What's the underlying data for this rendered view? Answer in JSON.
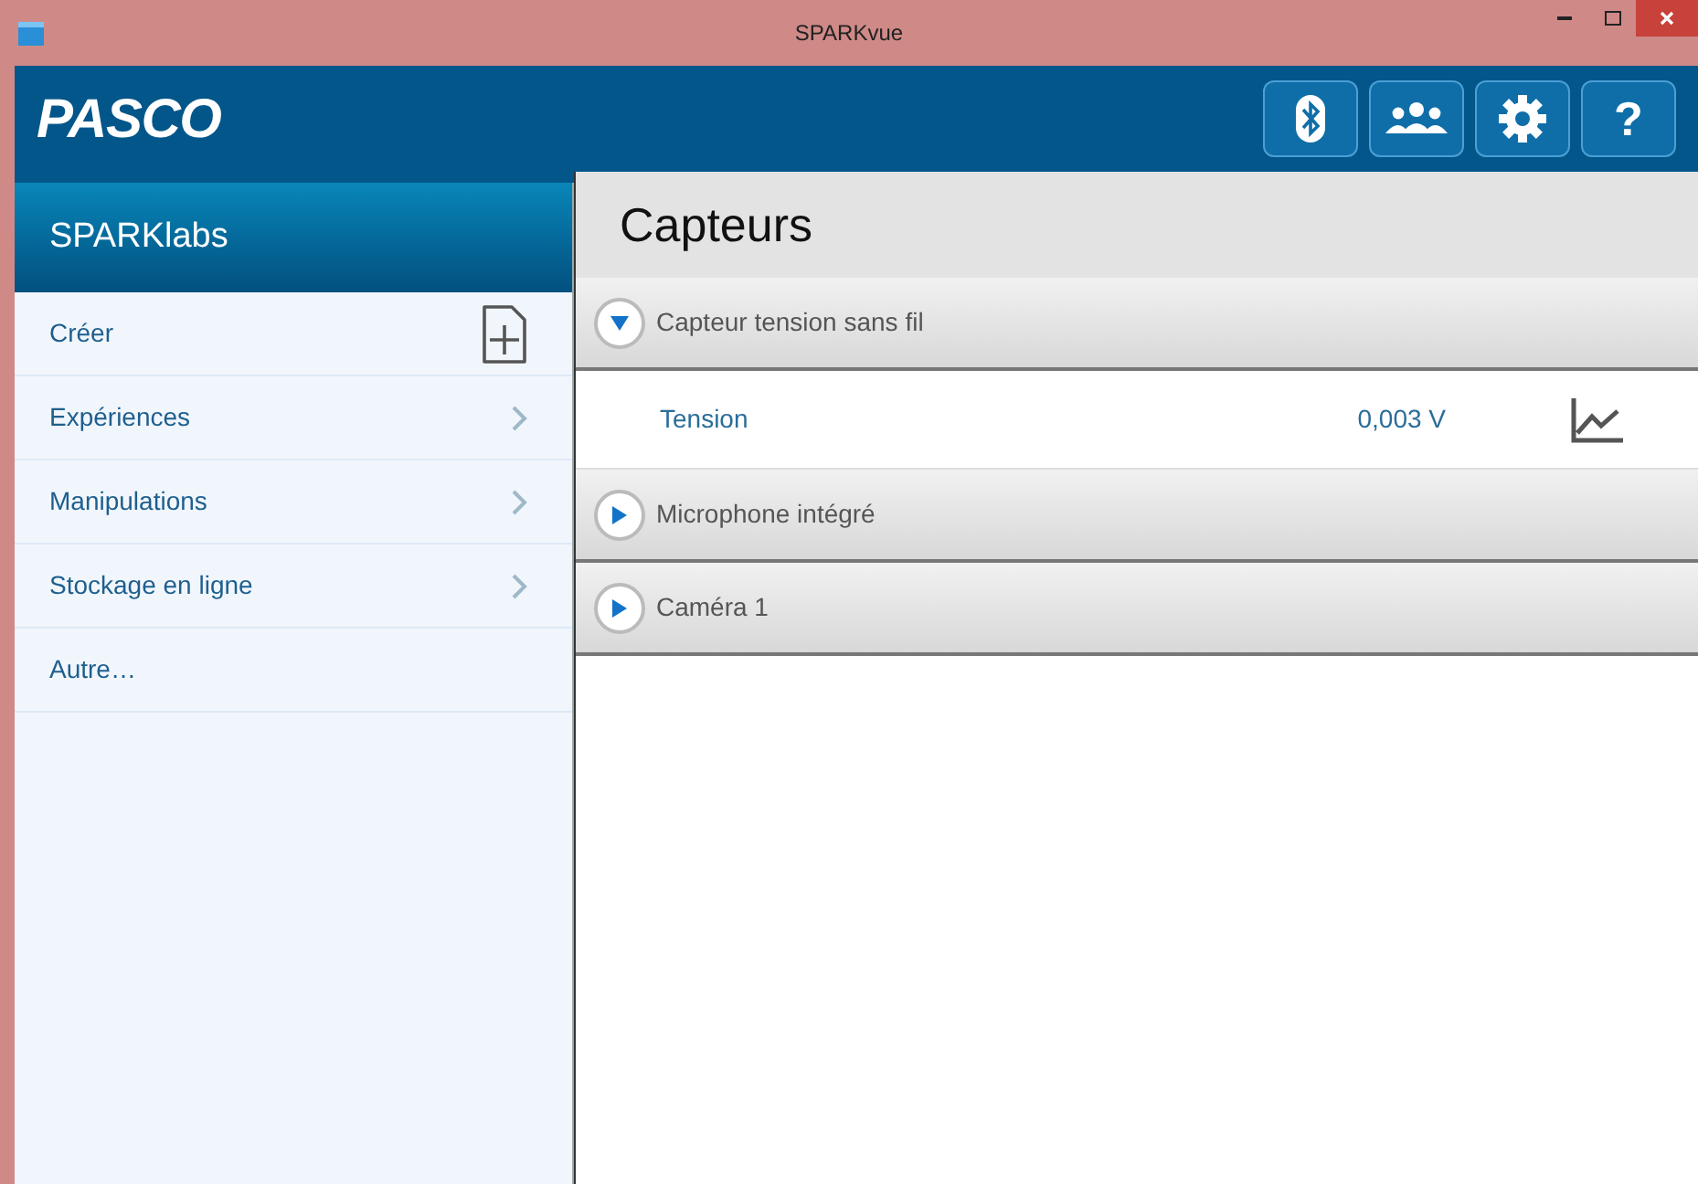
{
  "window": {
    "title": "SPARKvue"
  },
  "header": {
    "logo": "PASCO",
    "buttons": [
      {
        "kind": "bluetooth"
      },
      {
        "kind": "people"
      },
      {
        "kind": "settings"
      },
      {
        "kind": "help",
        "label": "?"
      }
    ]
  },
  "sidebar": {
    "title": "SPARKlabs",
    "items": [
      {
        "label": "Créer",
        "kind": "new"
      },
      {
        "label": "Expériences",
        "kind": "submenu"
      },
      {
        "label": "Manipulations",
        "kind": "submenu"
      },
      {
        "label": "Stockage en ligne",
        "kind": "submenu"
      },
      {
        "label": "Autre…",
        "kind": "plain"
      }
    ]
  },
  "main": {
    "title": "Capteurs",
    "sensors": [
      {
        "name": "Capteur tension sans fil",
        "expanded": true,
        "measurements": [
          {
            "name": "Tension",
            "value": "0,003 V"
          }
        ]
      },
      {
        "name": "Microphone intégré",
        "expanded": false
      },
      {
        "name": "Caméra 1",
        "expanded": false
      }
    ]
  }
}
